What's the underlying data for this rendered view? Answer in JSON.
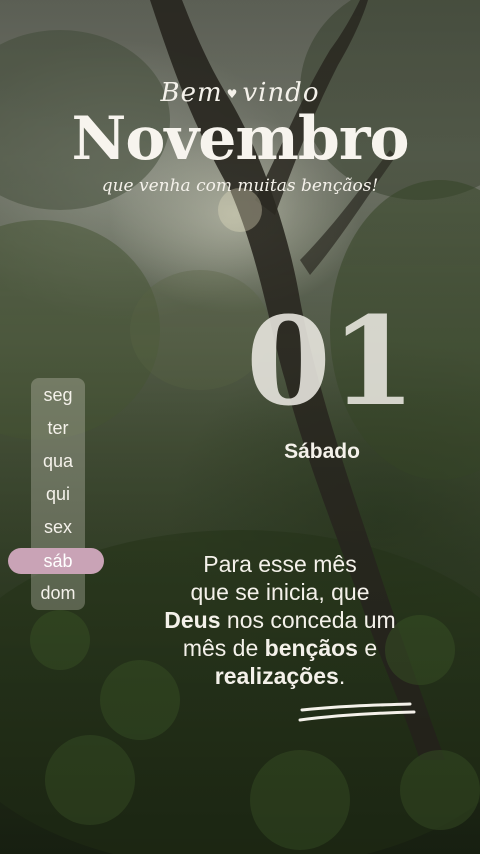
{
  "header": {
    "welcome_part1": "Bem",
    "welcome_part2": "vindo",
    "month": "Novembro",
    "blessing": "que venha com muitas bençãos!"
  },
  "date": {
    "day_number": "01",
    "weekday_name": "Sábado"
  },
  "week": {
    "days": [
      "seg",
      "ter",
      "qua",
      "qui",
      "sex",
      "sáb",
      "dom"
    ],
    "active": "sáb"
  },
  "message": {
    "line1": "Para esse mês",
    "line2": "que se inicia, que",
    "line3_bold": "Deus",
    "line3_rest": " nos conceda um",
    "line4_start": "mês de ",
    "line4_bold": "bençãos",
    "line4_end": " e",
    "line5_bold": "realizações",
    "line5_end": "."
  },
  "colors": {
    "text": "#f4f1ea",
    "active_day_pill": "#c9a3b6",
    "week_strip": "rgba(230,225,215,0.28)"
  }
}
